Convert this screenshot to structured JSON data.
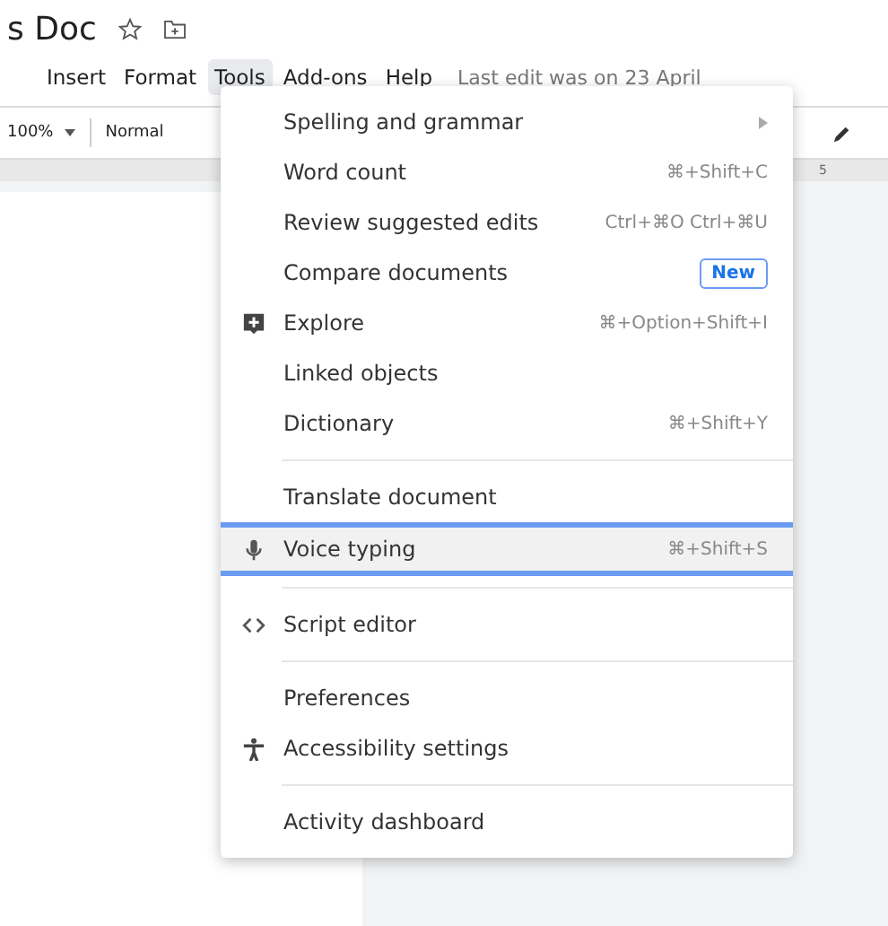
{
  "title": "s Doc",
  "menubar": [
    {
      "label": "Insert",
      "selected": false
    },
    {
      "label": "Format",
      "selected": false
    },
    {
      "label": "Tools",
      "selected": true
    },
    {
      "label": "Add-ons",
      "selected": false
    },
    {
      "label": "Help",
      "selected": false
    }
  ],
  "last_edit": "Last edit was on 23 April",
  "toolbar": {
    "zoom": "100%",
    "style": "Normal"
  },
  "ruler": {
    "mark": "5"
  },
  "menu": {
    "sections": [
      [
        {
          "label": "Spelling and grammar",
          "submenu": true,
          "selected": false
        },
        {
          "label": "Word count",
          "shortcut": "⌘+Shift+C",
          "selected": false
        },
        {
          "label": "Review suggested edits",
          "shortcut": "Ctrl+⌘O Ctrl+⌘U",
          "selected": false
        },
        {
          "label": "Compare documents",
          "badge": "New",
          "selected": false
        },
        {
          "label": "Explore",
          "kind": "explore",
          "shortcut": "⌘+Option+Shift+I",
          "selected": false
        },
        {
          "label": "Linked objects",
          "selected": false
        },
        {
          "label": "Dictionary",
          "shortcut": "⌘+Shift+Y",
          "selected": false
        }
      ],
      [
        {
          "label": "Translate document",
          "selected": false
        },
        {
          "label": "Voice typing",
          "kind": "mic",
          "shortcut": "⌘+Shift+S",
          "selected": true
        }
      ],
      [
        {
          "label": "Script editor",
          "kind": "code",
          "selected": false
        }
      ],
      [
        {
          "label": "Preferences",
          "selected": false
        },
        {
          "label": "Accessibility settings",
          "kind": "accessibility",
          "selected": false
        }
      ],
      [
        {
          "label": "Activity dashboard",
          "selected": false
        }
      ]
    ]
  }
}
